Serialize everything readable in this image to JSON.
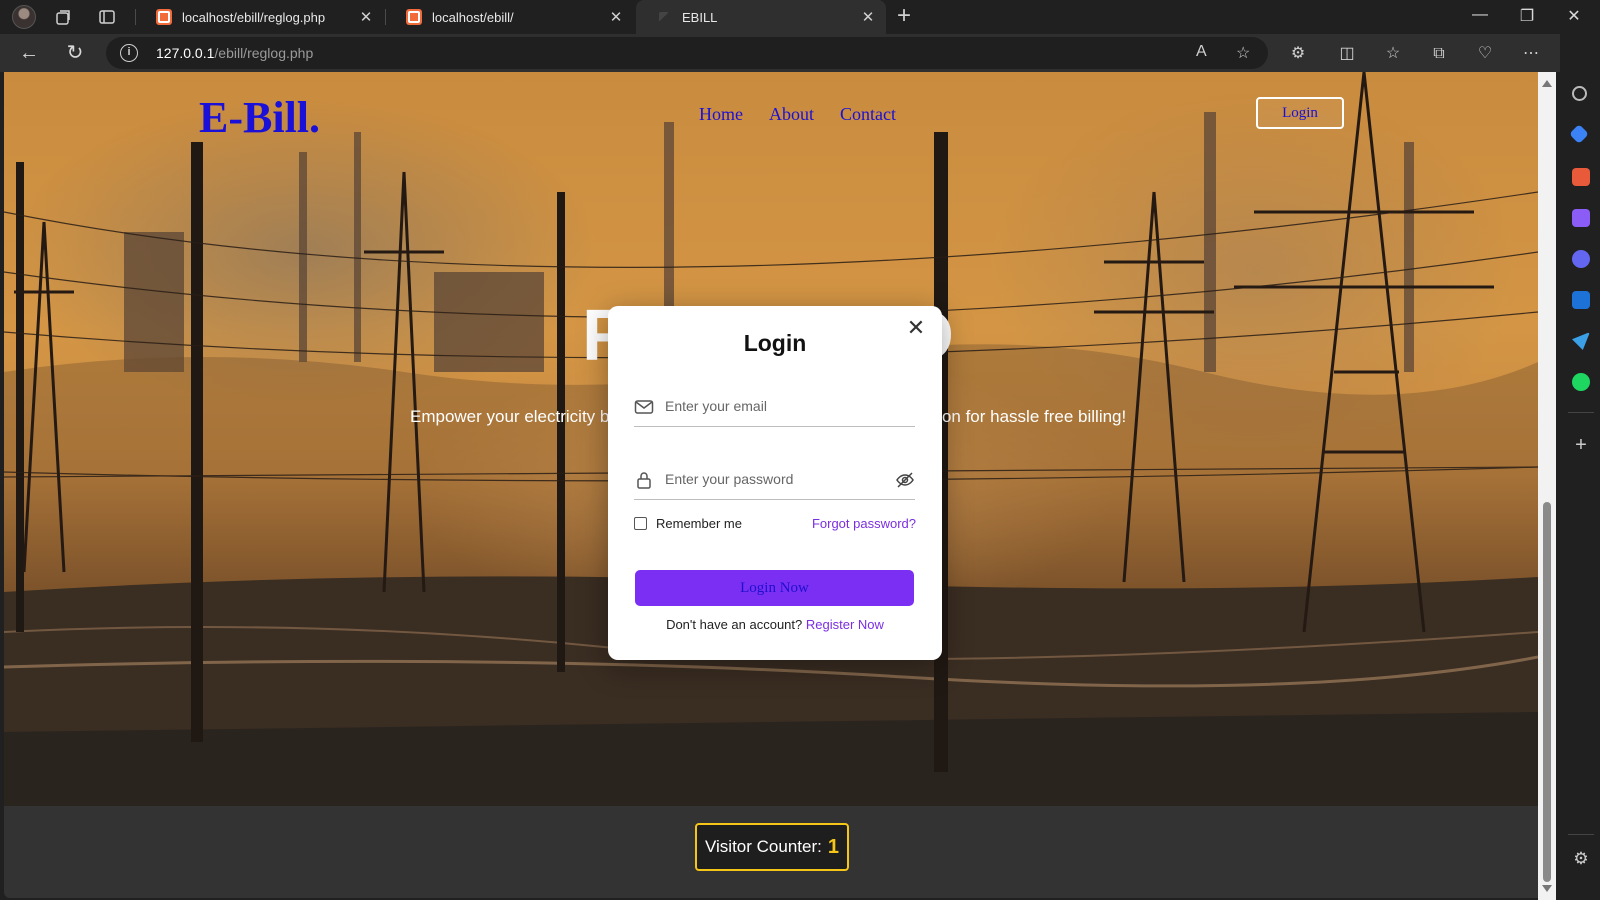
{
  "browser": {
    "tabs": [
      {
        "title": "localhost/ebill/reglog.php"
      },
      {
        "title": "localhost/ebill/"
      },
      {
        "title": "EBILL"
      }
    ],
    "url_host": "127.0.0.1",
    "url_path": "/ebill/reglog.php"
  },
  "site": {
    "logo": "E-Bill.",
    "nav": [
      "Home",
      "About",
      "Contact"
    ],
    "login_button": "Login",
    "hero_title_left": "F",
    "hero_title_right": "D",
    "hero_sub_left": "Empower your electricity b",
    "hero_sub_right": "ution for hassle free billing!"
  },
  "modal": {
    "title": "Login",
    "email_placeholder": "Enter your email",
    "password_placeholder": "Enter your password",
    "remember": "Remember me",
    "forgot": "Forgot password?",
    "submit": "Login Now",
    "no_account": "Don't have an account?",
    "register": "Register Now"
  },
  "footer": {
    "visitor_label": "Visitor Counter:",
    "visitor_count": "1"
  },
  "colors": {
    "brand_blue": "#1a10d8",
    "accent_purple": "#7b2ff2",
    "counter_yellow": "#f5c518"
  }
}
